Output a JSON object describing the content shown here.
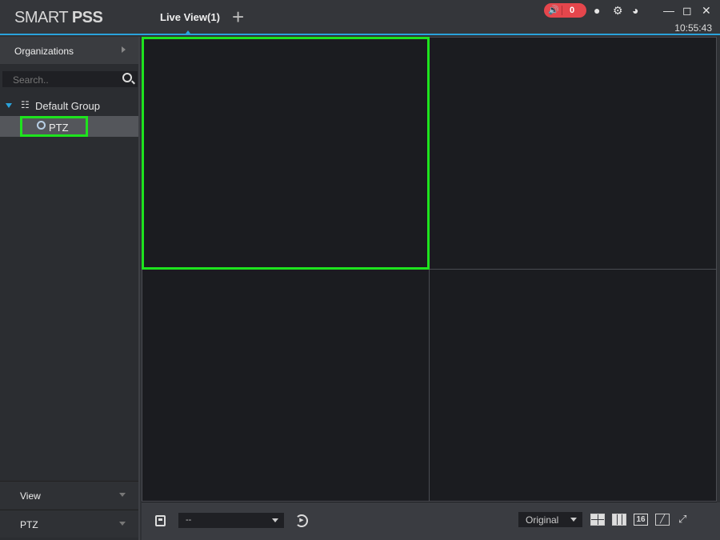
{
  "header": {
    "logo_light": "SMART ",
    "logo_bold": "PSS",
    "tab_label": "Live View(1)",
    "add_tab": "+",
    "alarm_count": "0",
    "clock": "10:55:43"
  },
  "sidebar": {
    "organizations": "Organizations",
    "search_placeholder": "Search..",
    "group": "Default Group",
    "device": "PTZ",
    "bottom_items": [
      "View",
      "PTZ"
    ]
  },
  "toolbar": {
    "view_select": "--",
    "scale_select": "Original",
    "layout16": "16"
  },
  "colors": {
    "accent": "#2aa3dc",
    "selection": "#1ee31e",
    "alarm": "#e5464c"
  }
}
